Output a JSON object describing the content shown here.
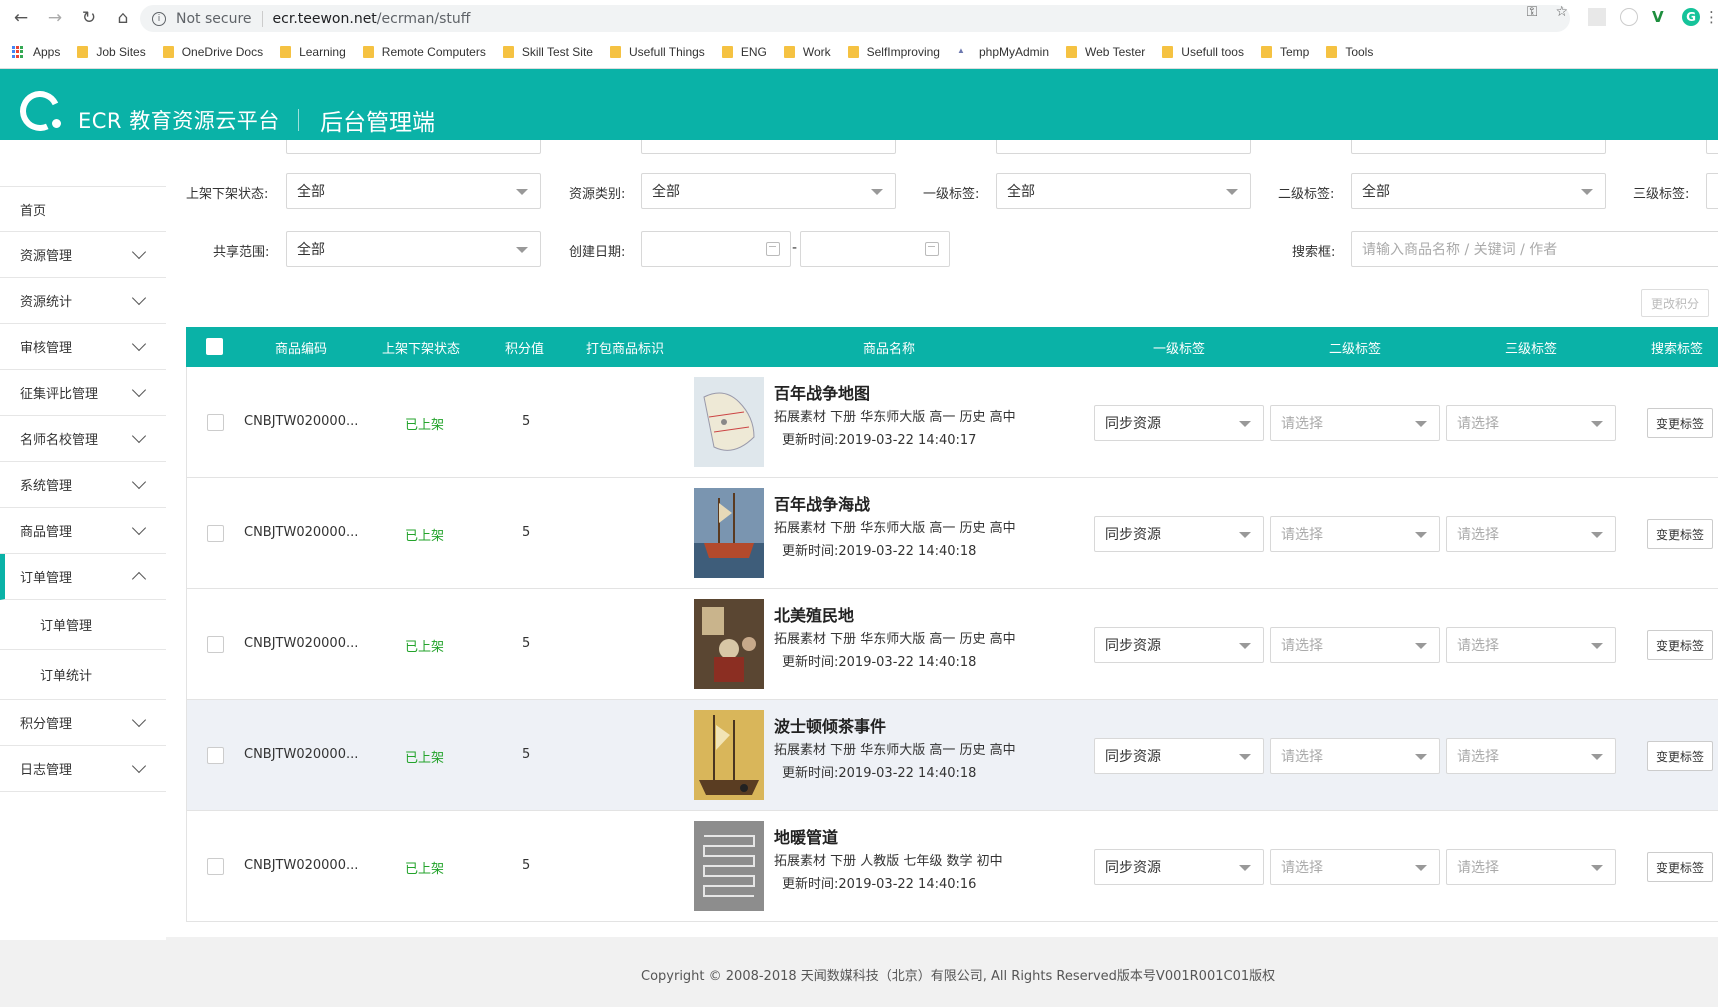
{
  "browser": {
    "secure_label": "Not secure",
    "url_host": "ecr.teewon.net",
    "url_path": "/ecrman/stuff",
    "bookmarks": [
      {
        "label": "Apps"
      },
      {
        "label": "Job Sites"
      },
      {
        "label": "OneDrive Docs"
      },
      {
        "label": "Learning"
      },
      {
        "label": "Remote Computers"
      },
      {
        "label": "Skill Test Site"
      },
      {
        "label": "Usefull Things"
      },
      {
        "label": "ENG"
      },
      {
        "label": "Work"
      },
      {
        "label": "SelfImproving"
      },
      {
        "label": "phpMyAdmin"
      },
      {
        "label": "Web Tester"
      },
      {
        "label": "Usefull toos"
      },
      {
        "label": "Temp"
      },
      {
        "label": "Tools"
      }
    ]
  },
  "header": {
    "brand": "ECR 教育资源云平台",
    "portal": "后台管理端",
    "accent": "#0ab2a7"
  },
  "sidebar": {
    "items": [
      {
        "label": "首页"
      },
      {
        "label": "资源管理"
      },
      {
        "label": "资源统计"
      },
      {
        "label": "审核管理"
      },
      {
        "label": "征集评比管理"
      },
      {
        "label": "名师名校管理"
      },
      {
        "label": "系统管理"
      },
      {
        "label": "商品管理"
      },
      {
        "label": "订单管理"
      },
      {
        "label": "积分管理"
      },
      {
        "label": "日志管理"
      }
    ],
    "sub_items": [
      {
        "label": "订单管理"
      },
      {
        "label": "订单统计"
      }
    ]
  },
  "filters": {
    "shelf_status_label": "上架下架状态:",
    "shelf_status_value": "全部",
    "resource_type_label": "资源类别:",
    "resource_type_value": "全部",
    "level1_label": "一级标签:",
    "level1_value": "全部",
    "level2_label": "二级标签:",
    "level2_value": "全部",
    "level3_label": "三级标签:",
    "share_scope_label": "共享范围:",
    "share_scope_value": "全部",
    "created_date_label": "创建日期:",
    "date_dash": "-",
    "search_label": "搜索框:",
    "search_placeholder": "请输入商品名称 / 关键词 / 作者",
    "change_points_button": "更改积分"
  },
  "table": {
    "headers": {
      "code": "商品编码",
      "status": "上架下架状态",
      "points": "积分值",
      "bundle": "打包商品标识",
      "name": "商品名称",
      "tag1": "一级标签",
      "tag2": "二级标签",
      "tag3": "三级标签",
      "search_tag": "搜索标签"
    },
    "rows": [
      {
        "code": "CNBJTW020000...",
        "status": "已上架",
        "points": "5",
        "title": "百年战争地图",
        "meta": "拓展素材 下册 华东师大版 高一 历史 高中",
        "time": "更新时间:2019-03-22 14:40:17",
        "tag1": "同步资源",
        "tag2": "请选择",
        "tag3": "请选择",
        "action": "变更标签"
      },
      {
        "code": "CNBJTW020000...",
        "status": "已上架",
        "points": "5",
        "title": "百年战争海战",
        "meta": "拓展素材 下册 华东师大版 高一 历史 高中",
        "time": "更新时间:2019-03-22 14:40:18",
        "tag1": "同步资源",
        "tag2": "请选择",
        "tag3": "请选择",
        "action": "变更标签"
      },
      {
        "code": "CNBJTW020000...",
        "status": "已上架",
        "points": "5",
        "title": "北美殖民地",
        "meta": "拓展素材 下册 华东师大版 高一 历史 高中",
        "time": "更新时间:2019-03-22 14:40:18",
        "tag1": "同步资源",
        "tag2": "请选择",
        "tag3": "请选择",
        "action": "变更标签"
      },
      {
        "code": "CNBJTW020000...",
        "status": "已上架",
        "points": "5",
        "title": "波士顿倾茶事件",
        "meta": "拓展素材 下册 华东师大版 高一 历史 高中",
        "time": "更新时间:2019-03-22 14:40:18",
        "tag1": "同步资源",
        "tag2": "请选择",
        "tag3": "请选择",
        "action": "变更标签"
      },
      {
        "code": "CNBJTW020000...",
        "status": "已上架",
        "points": "5",
        "title": "地暖管道",
        "meta": "拓展素材 下册 人教版 七年级 数学 初中",
        "time": "更新时间:2019-03-22 14:40:16",
        "tag1": "同步资源",
        "tag2": "请选择",
        "tag3": "请选择",
        "action": "变更标签"
      }
    ]
  },
  "footer": {
    "copyright": "Copyright © 2008-2018 天闻数媒科技（北京）有限公司, All Rights Reserved版本号V001R001C01版权"
  }
}
